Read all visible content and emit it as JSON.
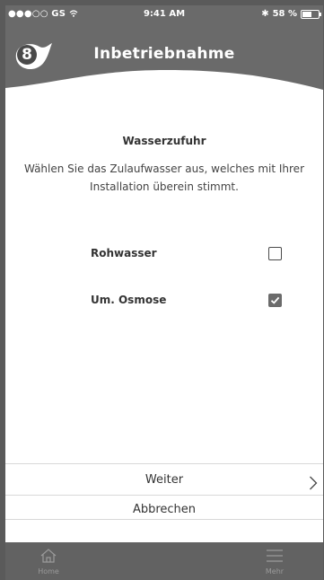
{
  "status_bar": {
    "carrier": "●●●○○ GS",
    "time": "9:41 AM",
    "battery": "58 %"
  },
  "header": {
    "step": "8",
    "title": "Inbetriebnahme"
  },
  "content": {
    "section_title": "Wasserzufuhr",
    "description": "Wählen Sie das Zulaufwasser aus, welches mit Ihrer Installation überein stimmt.",
    "options": [
      {
        "label": "Rohwasser",
        "checked": false
      },
      {
        "label": "Um. Osmose",
        "checked": true
      }
    ]
  },
  "actions": {
    "next_label": "Weiter",
    "cancel_label": "Abbrechen"
  },
  "tabbar": {
    "home_label": "Home",
    "more_label": "Mehr"
  },
  "colors": {
    "header": "#6a6a6a",
    "tabbar": "#626262",
    "text": "#333333"
  }
}
